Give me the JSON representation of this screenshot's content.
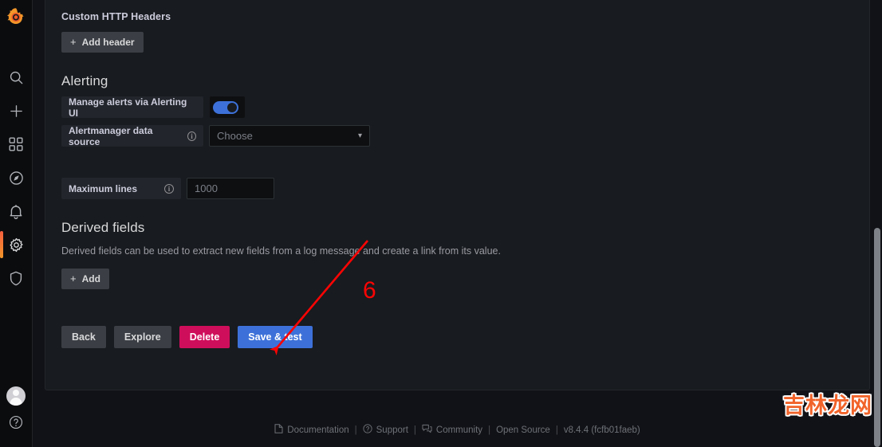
{
  "colors": {
    "accent_blue": "#3d71d9",
    "danger_pink": "#cf0e5b",
    "panel_bg": "#181b1f",
    "body_bg": "#111217",
    "annotation_red": "#fb0404",
    "watermark_orange": "#f1632a"
  },
  "sidebar": {
    "logo": "grafana-logo-icon",
    "items": [
      {
        "name": "search-icon",
        "label": "Search"
      },
      {
        "name": "plus-icon",
        "label": "Create"
      },
      {
        "name": "dashboards-grid-icon",
        "label": "Dashboards"
      },
      {
        "name": "explore-compass-icon",
        "label": "Explore"
      },
      {
        "name": "bell-icon",
        "label": "Alerting"
      },
      {
        "name": "gear-icon",
        "label": "Configuration"
      },
      {
        "name": "shield-icon",
        "label": "Server Admin"
      }
    ],
    "active_item": "gear-icon",
    "avatar_label": "User avatar",
    "help_label": "Help"
  },
  "main": {
    "custom_headers": {
      "title": "Custom HTTP Headers",
      "add_button": "Add header",
      "plus": "+"
    },
    "alerting": {
      "title": "Alerting",
      "manage_alerts_label": "Manage alerts via Alerting UI",
      "manage_alerts_enabled": true,
      "alertmanager_label": "Alertmanager data source",
      "alertmanager_value": "Choose",
      "info_glyph": "i"
    },
    "maximum_lines": {
      "label": "Maximum lines",
      "placeholder": "1000",
      "value": ""
    },
    "derived_fields": {
      "title": "Derived fields",
      "description": "Derived fields can be used to extract new fields from a log message and create a link from its value.",
      "add_button": "Add",
      "plus": "+"
    },
    "actions": {
      "back": "Back",
      "explore": "Explore",
      "delete": "Delete",
      "save_test": "Save & test"
    }
  },
  "footer": {
    "documentation": "Documentation",
    "support": "Support",
    "community": "Community",
    "open_source": "Open Source",
    "version": "v8.4.4 (fcfb01faeb)",
    "separator": "|"
  },
  "annotation": {
    "step_number": "6"
  },
  "watermark": {
    "text": "吉林龙网"
  }
}
